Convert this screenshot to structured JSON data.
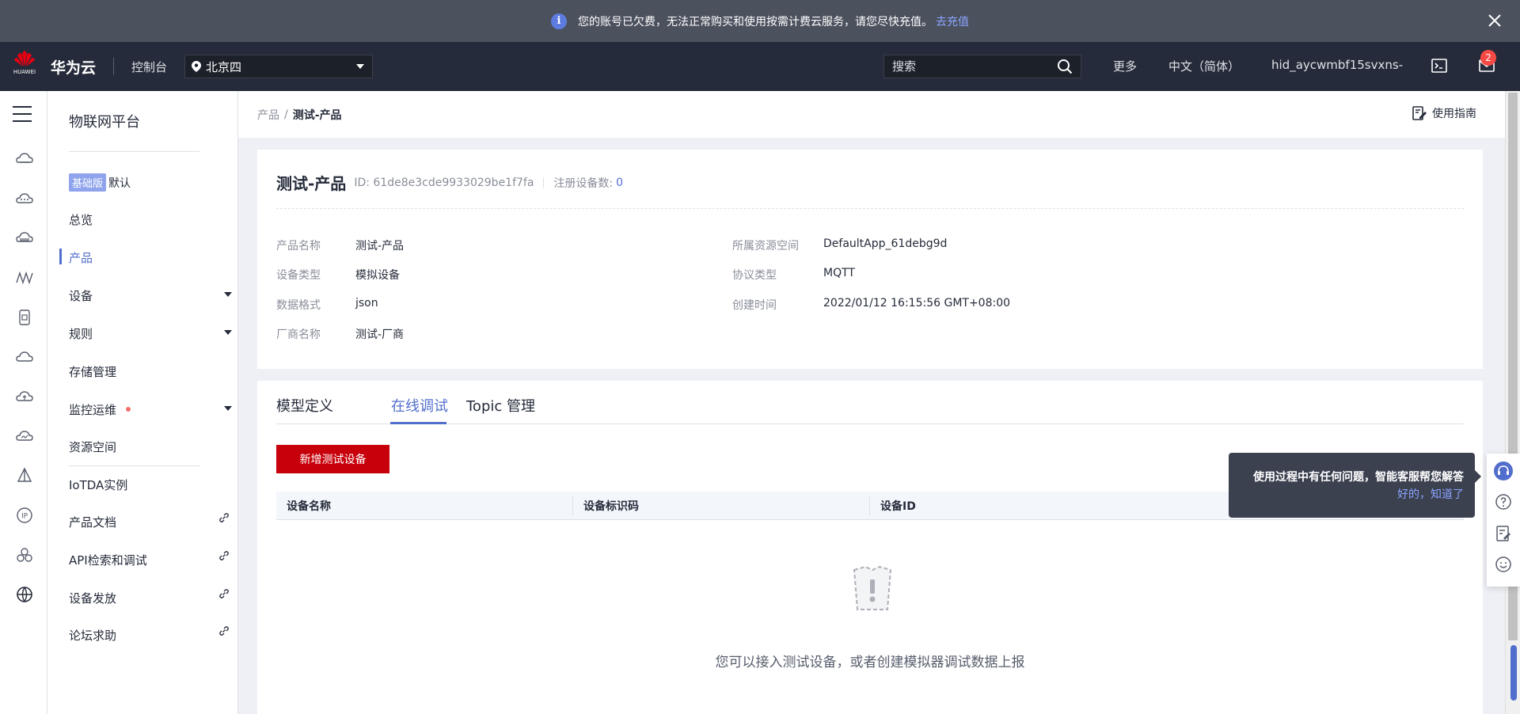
{
  "notice": {
    "text": "您的账号已欠费，无法正常购买和使用按需计费云服务，请您尽快充值。",
    "link": "去充值"
  },
  "topbar": {
    "brand": "华为云",
    "logo_text": "HUAWEI",
    "console": "控制台",
    "region": "北京四",
    "search_placeholder": "搜索",
    "more": "更多",
    "language": "中文（简体）",
    "user": "hid_aycwmbf15svxns-",
    "message_count": "2"
  },
  "sidebar": {
    "title": "物联网平台",
    "edition_tag": "基础版",
    "edition_name": "默认",
    "items": [
      {
        "label": "总览"
      },
      {
        "label": "产品"
      },
      {
        "label": "设备"
      },
      {
        "label": "规则"
      },
      {
        "label": "存储管理"
      },
      {
        "label": "监控运维"
      },
      {
        "label": "资源空间"
      },
      {
        "label": "IoTDA实例"
      },
      {
        "label": "产品文档"
      },
      {
        "label": "API检索和调试"
      },
      {
        "label": "设备发放"
      },
      {
        "label": "论坛求助"
      }
    ]
  },
  "breadcrumb": {
    "parent": "产品",
    "separator": "/",
    "current": "测试-产品"
  },
  "guide": "使用指南",
  "product": {
    "name": "测试-产品",
    "id_text": "ID: 61de8e3cde9933029be1f7fa",
    "device_count_label": "注册设备数:",
    "device_count": "0",
    "fields": {
      "name_k": "产品名称",
      "name_v": "测试-产品",
      "type_k": "设备类型",
      "type_v": "模拟设备",
      "format_k": "数据格式",
      "format_v": "json",
      "vendor_k": "厂商名称",
      "vendor_v": "测试-厂商",
      "space_k": "所属资源空间",
      "space_v": "DefaultApp_61debg9d",
      "protocol_k": "协议类型",
      "protocol_v": "MQTT",
      "created_k": "创建时间",
      "created_v": "2022/01/12 16:15:56 GMT+08:00"
    }
  },
  "tabs": [
    {
      "label": "模型定义"
    },
    {
      "label": "在线调试"
    },
    {
      "label": "Topic 管理"
    }
  ],
  "add_button": "新增测试设备",
  "table": {
    "columns": [
      "设备名称",
      "设备标识码",
      "设备ID"
    ]
  },
  "empty_text": "您可以接入测试设备，或者创建模拟器调试数据上报",
  "tooltip": {
    "title": "使用过程中有任何问题，智能客服帮您解答",
    "ok": "好的，知道了"
  },
  "colors": {
    "accent": "#526ecc",
    "brand_red": "#c7000b",
    "topbar": "#252b3a"
  }
}
